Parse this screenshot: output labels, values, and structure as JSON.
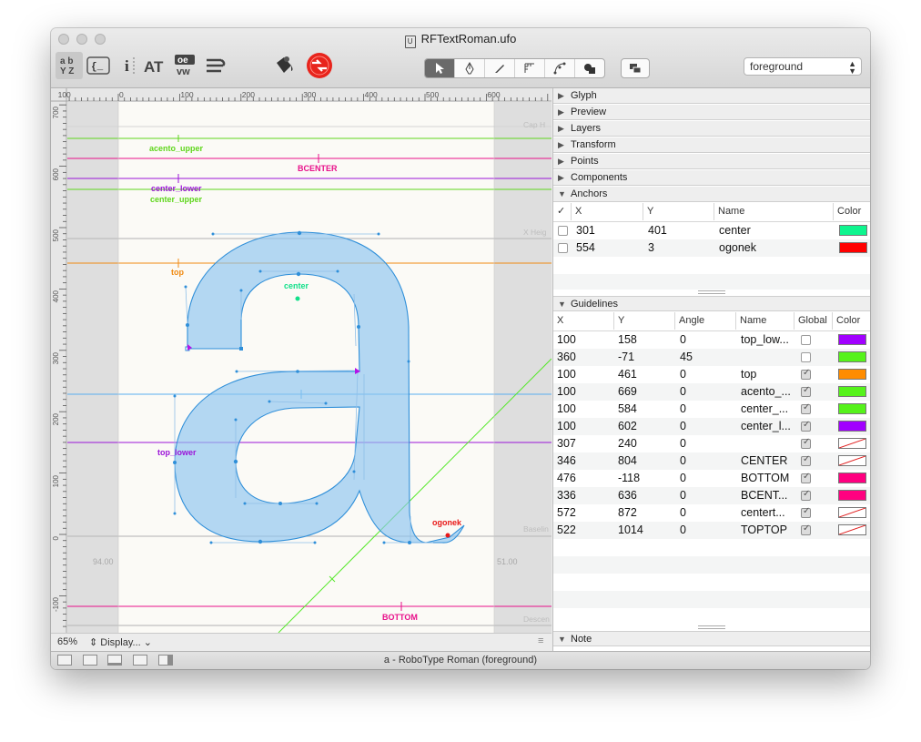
{
  "window": {
    "title": "RFTextRoman.ufo",
    "doc_icon": "U"
  },
  "toolbar": {
    "left_tools": [
      {
        "icon": "glyph-set-icon",
        "label": "ab/YZ"
      },
      {
        "icon": "script-icon",
        "label": "{_"
      },
      {
        "icon": "info-icon",
        "label": "i"
      },
      {
        "icon": "text-icon",
        "label": "AT"
      },
      {
        "icon": "ligature-icon",
        "label": "oe/vw"
      },
      {
        "icon": "stroke-icon",
        "label": "S"
      }
    ],
    "edit_tools": [
      "pointer-tool-icon",
      "pen-tool-icon",
      "knife-tool-icon",
      "ruler-tool-icon",
      "bezier-tool-icon",
      "shape-tool-icon"
    ],
    "layer_select": "foreground"
  },
  "editor": {
    "ruler_labels": [
      "100",
      "0",
      "100",
      "200",
      "300",
      "400",
      "500",
      "600",
      "700"
    ],
    "vruler_labels": [
      "700",
      "600",
      "500",
      "400",
      "300",
      "200",
      "100",
      "0",
      "-100"
    ],
    "zone_labels": [
      "Cap H",
      "X Heig",
      "Baselin",
      "Descen"
    ],
    "guide_labels": [
      {
        "text": "acento_upper",
        "color": "#5fd61c"
      },
      {
        "text": "BCENTER",
        "color": "#e8108a"
      },
      {
        "text": "center_lower",
        "color": "#9b14d8"
      },
      {
        "text": "center_upper",
        "color": "#5fd61c"
      },
      {
        "text": "top",
        "color": "#f08a12"
      },
      {
        "text": "top_lower",
        "color": "#9b14d8"
      },
      {
        "text": "BOTTOM",
        "color": "#e8108a"
      }
    ],
    "anchor_labels": [
      {
        "text": "center",
        "color": "#12e08a"
      },
      {
        "text": "ogonek",
        "color": "#e81818"
      }
    ],
    "sidebearings": {
      "left": "94.00",
      "right": "51.00"
    },
    "zoom": "65%",
    "display_label": "Display..."
  },
  "panel": {
    "sections": [
      "Glyph",
      "Preview",
      "Layers",
      "Transform",
      "Points",
      "Components",
      "Anchors"
    ],
    "anchors": {
      "columns": [
        "✓",
        "X",
        "Y",
        "Name",
        "Color"
      ],
      "rows": [
        {
          "x": "301",
          "y": "401",
          "name": "center",
          "color": "#0ef58e"
        },
        {
          "x": "554",
          "y": "3",
          "name": "ogonek",
          "color": "#ff0000"
        }
      ]
    },
    "guidelines": {
      "title": "Guidelines",
      "columns": [
        "X",
        "Y",
        "Angle",
        "Name",
        "Global",
        "Color"
      ],
      "rows": [
        {
          "x": "100",
          "y": "158",
          "angle": "0",
          "name": "top_low...",
          "global": false,
          "color": "#a100ff"
        },
        {
          "x": "360",
          "y": "-71",
          "angle": "45",
          "name": "",
          "global": false,
          "color": "#55f21a"
        },
        {
          "x": "100",
          "y": "461",
          "angle": "0",
          "name": "top",
          "global": true,
          "color": "#ff8c00"
        },
        {
          "x": "100",
          "y": "669",
          "angle": "0",
          "name": "acento_...",
          "global": true,
          "color": "#55f21a"
        },
        {
          "x": "100",
          "y": "584",
          "angle": "0",
          "name": "center_...",
          "global": true,
          "color": "#55f21a"
        },
        {
          "x": "100",
          "y": "602",
          "angle": "0",
          "name": "center_l...",
          "global": true,
          "color": "#a100ff"
        },
        {
          "x": "307",
          "y": "240",
          "angle": "0",
          "name": "",
          "global": true,
          "color": "none"
        },
        {
          "x": "346",
          "y": "804",
          "angle": "0",
          "name": "CENTER",
          "global": true,
          "color": "none"
        },
        {
          "x": "476",
          "y": "-118",
          "angle": "0",
          "name": "BOTTOM",
          "global": true,
          "color": "#ff0080"
        },
        {
          "x": "336",
          "y": "636",
          "angle": "0",
          "name": "BCENT...",
          "global": true,
          "color": "#ff0080"
        },
        {
          "x": "572",
          "y": "872",
          "angle": "0",
          "name": "centert...",
          "global": true,
          "color": "none"
        },
        {
          "x": "522",
          "y": "1014",
          "angle": "0",
          "name": "TOPTOP",
          "global": true,
          "color": "none"
        }
      ]
    },
    "note_label": "Note"
  },
  "statusbar": {
    "text": "a - RoboType Roman (foreground)"
  }
}
